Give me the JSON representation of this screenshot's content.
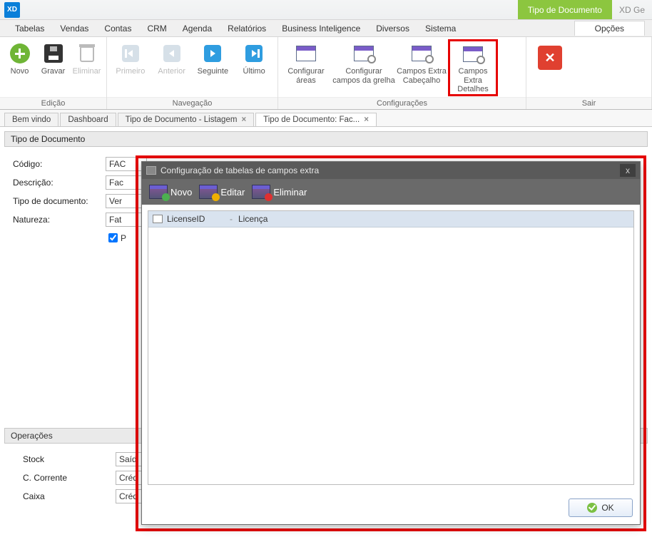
{
  "app": {
    "logo_text": "XD",
    "title_right": "XD Ge",
    "context_tab": "Tipo de Documento"
  },
  "menu": {
    "items": [
      "Tabelas",
      "Vendas",
      "Contas",
      "CRM",
      "Agenda",
      "Relatórios",
      "Business Inteligence",
      "Diversos",
      "Sistema"
    ],
    "options": "Opções"
  },
  "ribbon": {
    "edicao": {
      "label": "Edição",
      "novo": "Novo",
      "gravar": "Gravar",
      "eliminar": "Eliminar"
    },
    "navegacao": {
      "label": "Navegação",
      "primeiro": "Primeiro",
      "anterior": "Anterior",
      "seguinte": "Seguinte",
      "ultimo": "Último"
    },
    "config": {
      "label": "Configurações",
      "areas": "Configurar áreas",
      "grelha": "Configurar campos da grelha",
      "cabecalho": "Campos Extra Cabeçalho",
      "detalhes": "Campos Extra Detalhes"
    },
    "sair": {
      "label": "Sair"
    }
  },
  "tabs": {
    "t0": "Bem vindo",
    "t1": "Dashboard",
    "t2": "Tipo de Documento - Listagem",
    "t3": "Tipo de Documento: Fac..."
  },
  "section_title": "Tipo de Documento",
  "form": {
    "codigo_label": "Código:",
    "codigo_val": "FAC",
    "descricao_label": "Descrição:",
    "descricao_val": "Fac",
    "tipo_label": "Tipo de documento:",
    "tipo_val": "Ver",
    "natureza_label": "Natureza:",
    "natureza_val": "Fat",
    "checkbox_label": "P"
  },
  "operacoes": {
    "title": "Operações",
    "stock_label": "Stock",
    "stock_val": "Saíd",
    "cc_label": "C. Corrente",
    "cc_val": "Créd",
    "caixa_label": "Caixa",
    "caixa_val": "Créd"
  },
  "dialog": {
    "title": "Configuração de tabelas de campos extra",
    "novo": "Novo",
    "editar": "Editar",
    "eliminar": "Eliminar",
    "row_id": "LicenseID",
    "row_sep": "-",
    "row_name": "Licença",
    "ok": "OK",
    "close": "x"
  }
}
